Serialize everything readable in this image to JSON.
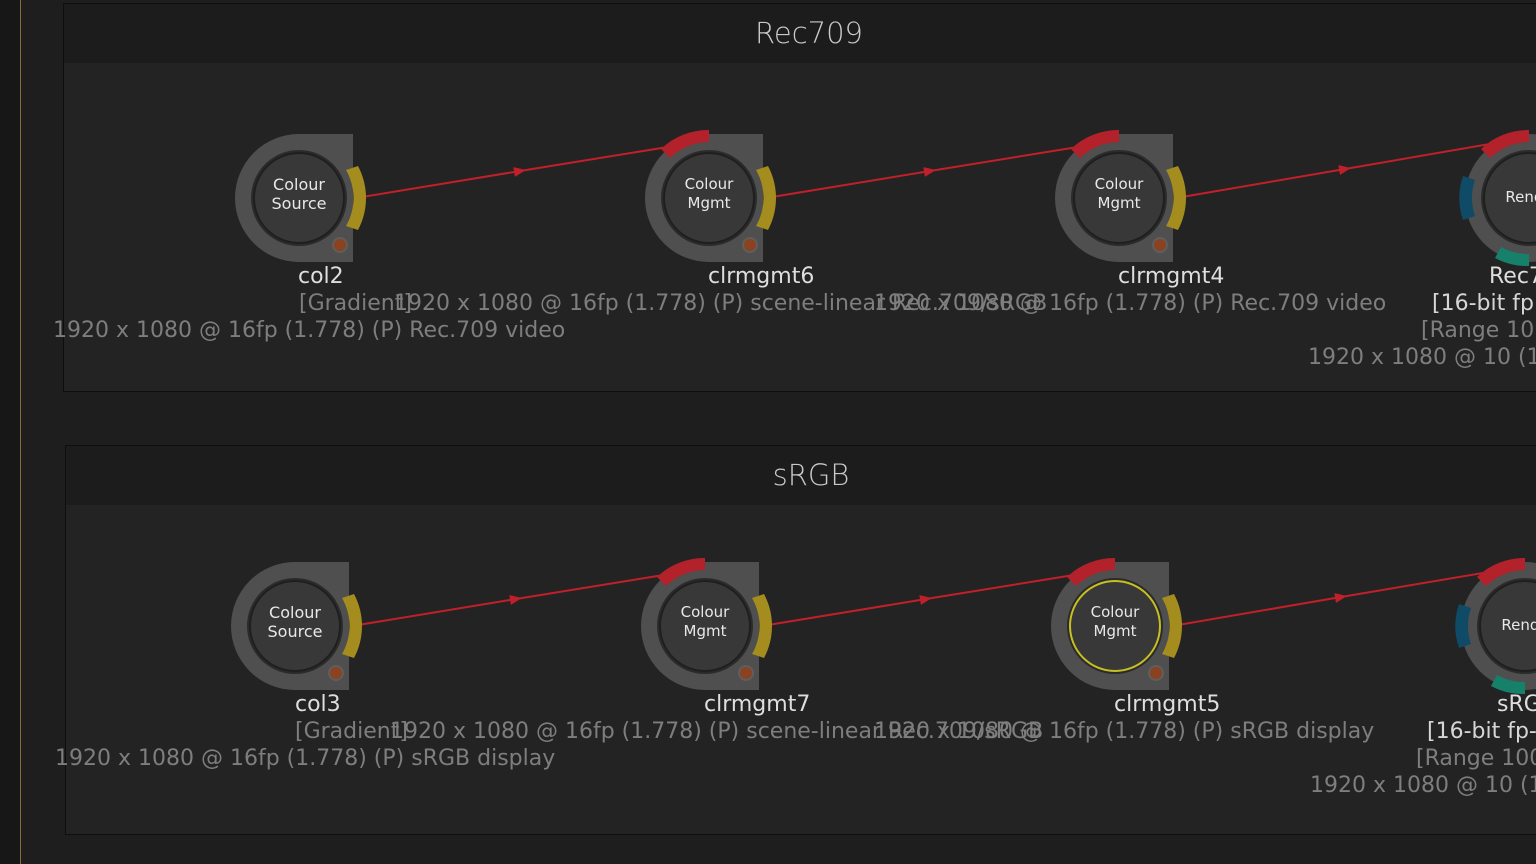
{
  "backdrops": [
    {
      "title": "Rec709",
      "nodes": [
        {
          "label_1": "Colour",
          "label_2": "Source",
          "name": "col2",
          "info_1": "[Gradient]",
          "info_2": "1920 x 1080 @ 16fp (1.778) (P) Rec.709 video"
        },
        {
          "label_1": "Colour",
          "label_2": "Mgmt",
          "name": "clrmgmt6",
          "info_1": "1920 x 1080 @ 16fp (1.778) (P) scene-linear Rec.709/sRGB"
        },
        {
          "label_1": "Colour",
          "label_2": "Mgmt",
          "name": "clrmgmt4",
          "info_1": "1920 x 1080 @ 16fp (1.778) (P) Rec.709 video"
        },
        {
          "label_1": "Rende",
          "name": "Rec7",
          "info_1": "[16-bit fp",
          "info_2": "[Range  10",
          "info_3": "1920 x 1080 @ 10 (1"
        }
      ]
    },
    {
      "title": "sRGB",
      "nodes": [
        {
          "label_1": "Colour",
          "label_2": "Source",
          "name": "col3",
          "info_1": "[Gradient]",
          "info_2": "1920 x 1080 @ 16fp (1.778) (P) sRGB display"
        },
        {
          "label_1": "Colour",
          "label_2": "Mgmt",
          "name": "clrmgmt7",
          "info_1": "1920 x 1080 @ 16fp (1.778) (P) scene-linear Rec.709/sRGB"
        },
        {
          "label_1": "Colour",
          "label_2": "Mgmt",
          "name": "clrmgmt5",
          "info_1": "1920 x 1080 @ 16fp (1.778) (P) sRGB display"
        },
        {
          "label_1": "Rende",
          "name": "sRG",
          "info_1": "[16-bit fp-",
          "info_2": "[Range  100",
          "info_3": "1920 x 1080 @ 10 (1"
        }
      ]
    }
  ],
  "colors": {
    "wire": "#c1202a",
    "output_tab": "#a48d1e",
    "input_tab": "#b3212a",
    "render_side": "#0f4a66",
    "render_bottom": "#17806a",
    "selected_outline": "#c8c020"
  }
}
